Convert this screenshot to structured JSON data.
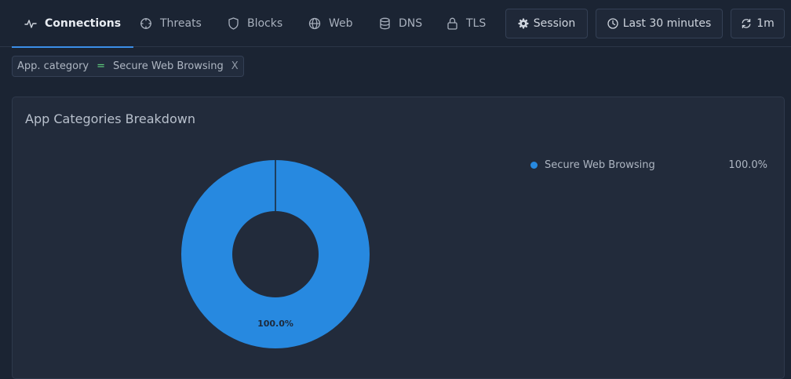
{
  "nav": {
    "tabs": [
      {
        "label": "Connections",
        "icon": "activity-icon",
        "active": true
      },
      {
        "label": "Threats",
        "icon": "crosshair-icon"
      },
      {
        "label": "Blocks",
        "icon": "shield-icon"
      },
      {
        "label": "Web",
        "icon": "globe-icon"
      },
      {
        "label": "DNS",
        "icon": "database-icon"
      },
      {
        "label": "TLS",
        "icon": "lock-icon"
      }
    ],
    "session_label": "Session",
    "time_range_label": "Last 30 minutes",
    "refresh_label": "1m"
  },
  "filter": {
    "field": "App. category",
    "operator": "=",
    "value": "Secure Web Browsing",
    "remove_label": "X"
  },
  "panel": {
    "title": "App Categories Breakdown"
  },
  "colors": {
    "accent": "#3b8ee8",
    "slice": "#2789e0",
    "operator": "#5fcf7d"
  },
  "chart_data": {
    "type": "pie",
    "title": "App Categories Breakdown",
    "categories": [
      "Secure Web Browsing"
    ],
    "values": [
      100.0
    ],
    "value_labels": [
      "100.0%"
    ],
    "legend": "right"
  }
}
